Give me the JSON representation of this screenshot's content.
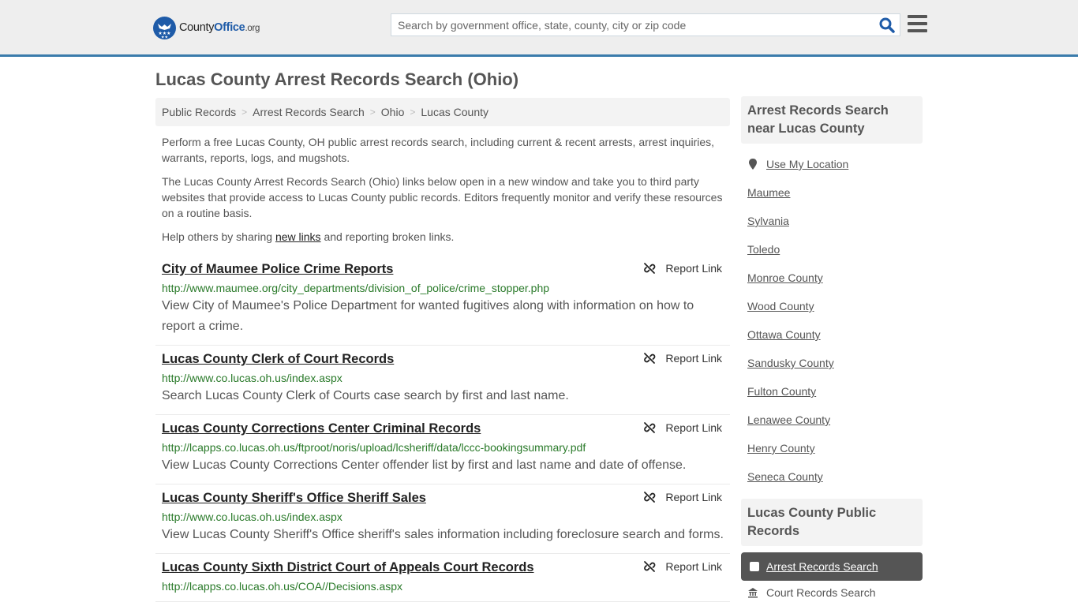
{
  "header": {
    "logo": {
      "county": "County",
      "office": "Office",
      "org": ".org"
    },
    "search_placeholder": "Search by government office, state, county, city or zip code",
    "search_icon": "search-icon",
    "menu_icon": "hamburger-menu-icon"
  },
  "page": {
    "title": "Lucas County Arrest Records Search (Ohio)",
    "breadcrumb": [
      "Public Records",
      "Arrest Records Search",
      "Ohio",
      "Lucas County"
    ],
    "intro": [
      "Perform a free Lucas County, OH public arrest records search, including current & recent arrests, arrest inquiries, warrants, reports, logs, and mugshots.",
      "The Lucas County Arrest Records Search (Ohio) links below open in a new window and take you to third party websites that provide access to Lucas County public records. Editors frequently monitor and verify these resources on a routine basis."
    ],
    "help": {
      "before": "Help others by sharing ",
      "link": "new links",
      "after": " and reporting broken links."
    }
  },
  "report_label": "Report Link",
  "results": [
    {
      "title": "City of Maumee Police Crime Reports",
      "url": "http://www.maumee.org/city_departments/division_of_police/crime_stopper.php",
      "desc": "View City of Maumee's Police Department for wanted fugitives along with information on how to report a crime."
    },
    {
      "title": "Lucas County Clerk of Court Records",
      "url": "http://www.co.lucas.oh.us/index.aspx",
      "desc": "Search Lucas County Clerk of Courts case search by first and last name."
    },
    {
      "title": "Lucas County Corrections Center Criminal Records",
      "url": "http://lcapps.co.lucas.oh.us/ftproot/noris/upload/lcsheriff/data/lccc-bookingsummary.pdf",
      "desc": "View Lucas County Corrections Center offender list by first and last name and date of offense."
    },
    {
      "title": "Lucas County Sheriff's Office Sheriff Sales",
      "url": "http://www.co.lucas.oh.us/index.aspx",
      "desc": "View Lucas County Sheriff's Office sheriff's sales information including foreclosure search and forms."
    },
    {
      "title": "Lucas County Sixth District Court of Appeals Court Records",
      "url": "http://lcapps.co.lucas.oh.us/COA//Decisions.aspx",
      "desc": ""
    }
  ],
  "sidebar": {
    "nearby_heading": "Arrest Records Search near Lucas County",
    "use_location": "Use My Location",
    "nearby": [
      "Maumee",
      "Sylvania",
      "Toledo",
      "Monroe County",
      "Wood County",
      "Ottawa County",
      "Sandusky County",
      "Fulton County",
      "Lenawee County",
      "Henry County",
      "Seneca County"
    ],
    "records_heading": "Lucas County Public Records",
    "active_item": "Arrest Records Search",
    "next_item": "Court Records Search"
  },
  "colors": {
    "brand": "#1e5ba8",
    "header_border": "#3a7bab",
    "url_green": "#2a7a2a"
  }
}
